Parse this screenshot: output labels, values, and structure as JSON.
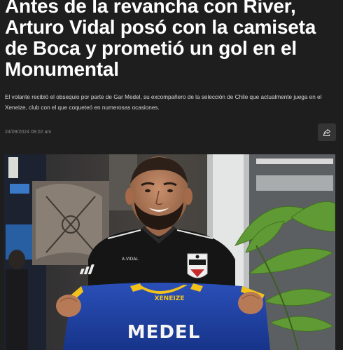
{
  "article": {
    "headline": "Antes de la revancha con River, Arturo Vidal posó con la camiseta de Boca y prometió un gol en el Monumental",
    "lead": "El volante recibió el obsequio por parte de Gar Medel, su excompañero de la selección de Chile que actualmente juega en el Xeneize, club con el que coqueteó en numerosas ocasiones.",
    "timestamp": "24/09/2024 08:02 am",
    "share_icon": "share-icon"
  },
  "photo": {
    "jersey_club_text": "XENEIZE",
    "jersey_name": "MEDEL",
    "shirt_label": "A.VIDAL",
    "colors": {
      "jersey_blue": "#1e3f9e",
      "jersey_yellow": "#f2c21b",
      "shirt_black": "#151515",
      "plant_green": "#5f9a34"
    }
  }
}
